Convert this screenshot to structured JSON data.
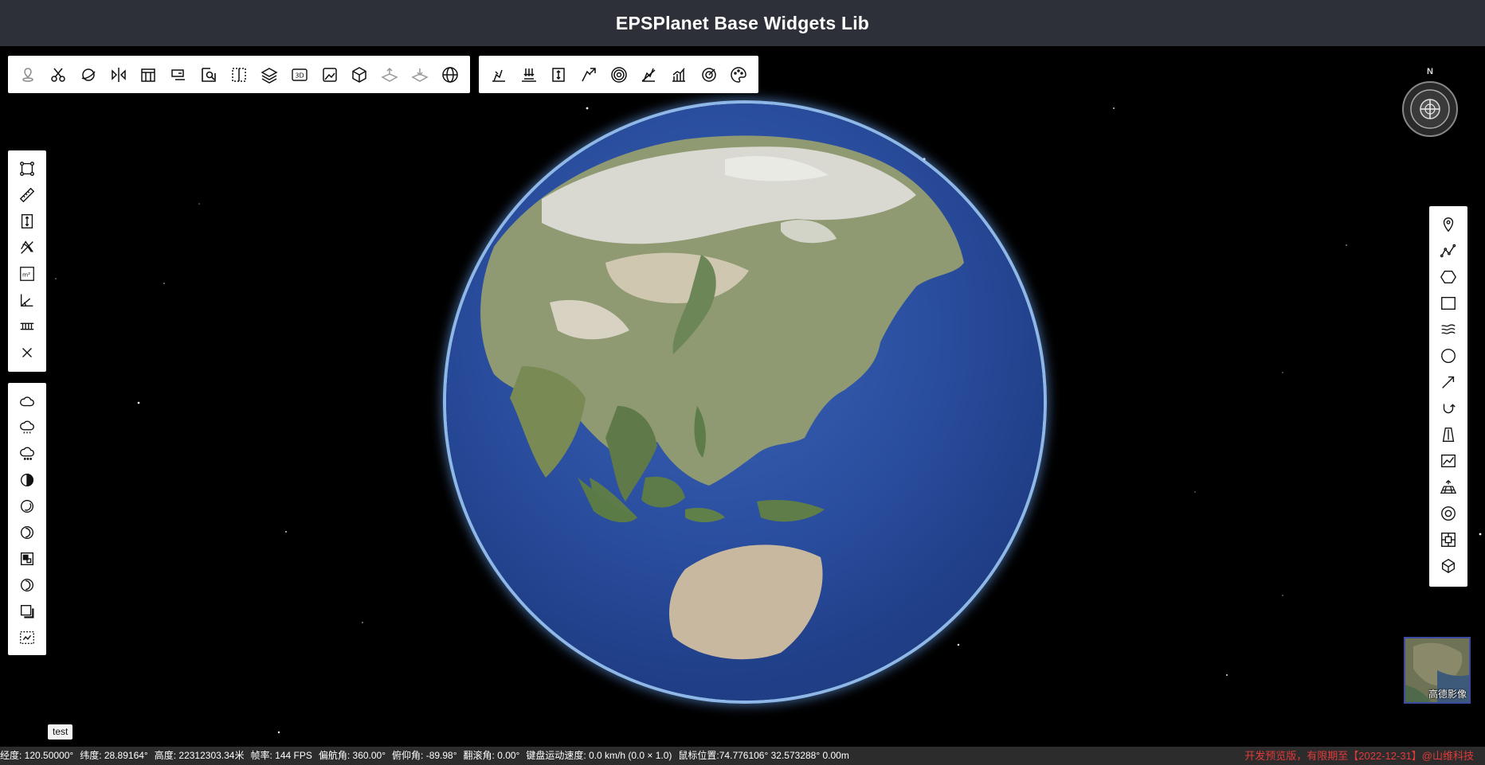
{
  "header": {
    "title": "EPSPlanet Base Widgets Lib"
  },
  "toolbars": {
    "top_left": [
      {
        "name": "location-marker-icon",
        "label": "定位"
      },
      {
        "name": "cut-icon",
        "label": "裁剪"
      },
      {
        "name": "rotate-sphere-icon",
        "label": "绕点旋转"
      },
      {
        "name": "split-compare-icon",
        "label": "卷帘对比"
      },
      {
        "name": "building-icon",
        "label": "建筑"
      },
      {
        "name": "screen-capture-icon",
        "label": "截图"
      },
      {
        "name": "magnify-search-icon",
        "label": "查询"
      },
      {
        "name": "split-screen-icon",
        "label": "分屏"
      },
      {
        "name": "layers-icon",
        "label": "图层"
      },
      {
        "name": "3d-badge-icon",
        "label": "3D"
      },
      {
        "name": "image-icon",
        "label": "影像"
      },
      {
        "name": "cube-icon",
        "label": "模型"
      },
      {
        "name": "layer-up-icon",
        "label": "抬升"
      },
      {
        "name": "layer-down-icon",
        "label": "下沉"
      },
      {
        "name": "globe-grid-icon",
        "label": "经纬网"
      }
    ],
    "top_right": [
      {
        "name": "excavate-icon",
        "label": "开挖"
      },
      {
        "name": "flood-icon",
        "label": "淹没"
      },
      {
        "name": "height-limit-icon",
        "label": "限高"
      },
      {
        "name": "slope-icon",
        "label": "坡度"
      },
      {
        "name": "buffer-rings-icon",
        "label": "缓冲区"
      },
      {
        "name": "profile-icon",
        "label": "剖面"
      },
      {
        "name": "chart-bars-icon",
        "label": "统计"
      },
      {
        "name": "target-icon",
        "label": "视域"
      },
      {
        "name": "palette-icon",
        "label": "调色"
      }
    ],
    "left_measure": [
      {
        "name": "measure-area-box-icon"
      },
      {
        "name": "ruler-icon"
      },
      {
        "name": "measure-height-icon"
      },
      {
        "name": "measure-path-icon"
      },
      {
        "name": "square-meter-icon"
      },
      {
        "name": "measure-angle-icon"
      },
      {
        "name": "measure-section-icon"
      },
      {
        "name": "clear-icon"
      }
    ],
    "left_weather": [
      {
        "name": "cloud-icon"
      },
      {
        "name": "rain-icon"
      },
      {
        "name": "snow-icon"
      },
      {
        "name": "fog-icon"
      },
      {
        "name": "moon-icon"
      },
      {
        "name": "daylight-icon"
      },
      {
        "name": "tile-icon"
      },
      {
        "name": "night-icon"
      },
      {
        "name": "shadow-icon"
      },
      {
        "name": "frame-select-icon"
      }
    ],
    "right_draw": [
      {
        "name": "point-pin-icon"
      },
      {
        "name": "polyline-icon"
      },
      {
        "name": "hexagon-icon"
      },
      {
        "name": "rectangle-icon"
      },
      {
        "name": "water-waves-icon"
      },
      {
        "name": "circle-icon"
      },
      {
        "name": "straight-arrow-icon"
      },
      {
        "name": "curved-arrow-icon"
      },
      {
        "name": "wall-icon"
      },
      {
        "name": "line-chart-icon"
      },
      {
        "name": "grid-plane-icon"
      },
      {
        "name": "ring-icon"
      },
      {
        "name": "square-frame-icon"
      },
      {
        "name": "box-model-icon"
      }
    ]
  },
  "compass": {
    "north_label": "N"
  },
  "basemap": {
    "label": "高德影像"
  },
  "test_tag": "test",
  "status": {
    "lon": "经度: 120.50000°",
    "lat": "纬度: 28.89164°",
    "height": "高度: 22312303.34米",
    "fps": "帧率: 144 FPS",
    "heading": "偏航角: 360.00°",
    "pitch": "俯仰角: -89.98°",
    "roll": "翻滚角: 0.00°",
    "speed": "键盘运动速度: 0.0 km/h (0.0 × 1.0)",
    "mouse": "鼠标位置:74.776106° 32.573288° 0.00m",
    "notice": "开发预览版，有限期至【2022-12-31】@山维科技"
  }
}
